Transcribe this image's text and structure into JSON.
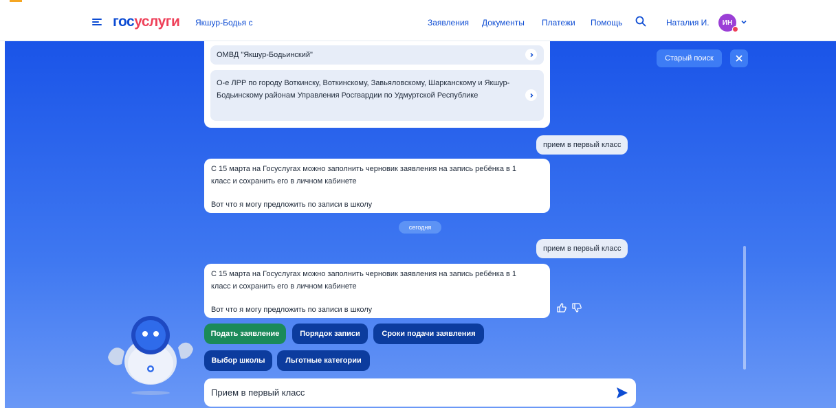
{
  "header": {
    "logo_part1": "гос",
    "logo_part2": "услуги",
    "city": "Якшур-Бодья с",
    "nav": [
      "Заявления",
      "Документы",
      "Платежи",
      "Помощь"
    ],
    "user_name": "Наталия И.",
    "avatar_initials": "ИН"
  },
  "chat": {
    "org_items": [
      "ОМВД \"Якшур-Бодьинский\"",
      "О-е ЛРР по городу Воткинску, Воткинскому, Завьяловскому, Шарканскому и Якшур-Бодьинскому районам Управления Росгвардии по Удмуртской Республике"
    ],
    "user_msg_1": "прием в первый класс",
    "bot_msg_1": {
      "p1": "С 15 марта на Госуслугах можно заполнить черновик заявления на запись ребёнка в 1 класс и сохранить его в личном кабинете",
      "p2": "Вот что я могу предложить по записи в школу"
    },
    "date_label": "сегодня",
    "user_msg_2": "прием в первый класс",
    "bot_msg_2": {
      "p1": "С 15 марта на Госуслугах можно заполнить черновик заявления на запись ребёнка в 1 класс и сохранить его в личном кабинете",
      "p2": "Вот что я могу предложить по записи в школу"
    },
    "chips_row1": [
      "Подать заявление",
      "Порядок записи",
      "Сроки подачи заявления"
    ],
    "chips_row2": [
      "Выбор школы",
      "Льготные категории"
    ],
    "input_value": "Прием в первый класс",
    "old_search_label": "Старый поиск"
  },
  "colors": {
    "brand_blue": "#0d4cd3",
    "brand_red": "#ee3f58",
    "chip_dark": "#0c3c9e",
    "chip_green": "#1b8a5a"
  },
  "icons": [
    "menu-icon",
    "search-icon",
    "chevron-down-icon",
    "chevron-right-icon",
    "close-icon",
    "thumbs-up-icon",
    "thumbs-down-icon",
    "send-icon",
    "robot-mascot"
  ]
}
